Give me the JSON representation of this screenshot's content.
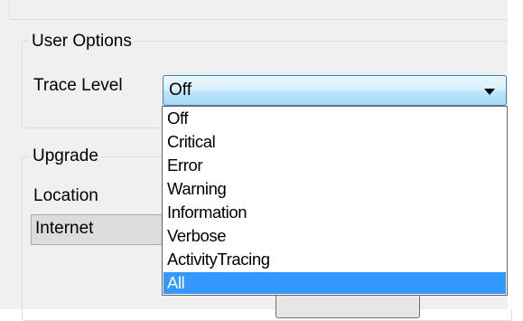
{
  "user_options": {
    "group_title": "User Options",
    "trace_level_label": "Trace Level",
    "trace_level_value": "Off"
  },
  "upgrade": {
    "group_title": "Upgrade",
    "location_label": "Location",
    "location_value": "Internet"
  },
  "trace_level_options": [
    "Off",
    "Critical",
    "Error",
    "Warning",
    "Information",
    "Verbose",
    "ActivityTracing",
    "All"
  ],
  "highlighted_option": "All",
  "colors": {
    "highlight": "#3399ff",
    "combo_border": "#3c7fb1",
    "panel_background": "#f0f0f0"
  }
}
